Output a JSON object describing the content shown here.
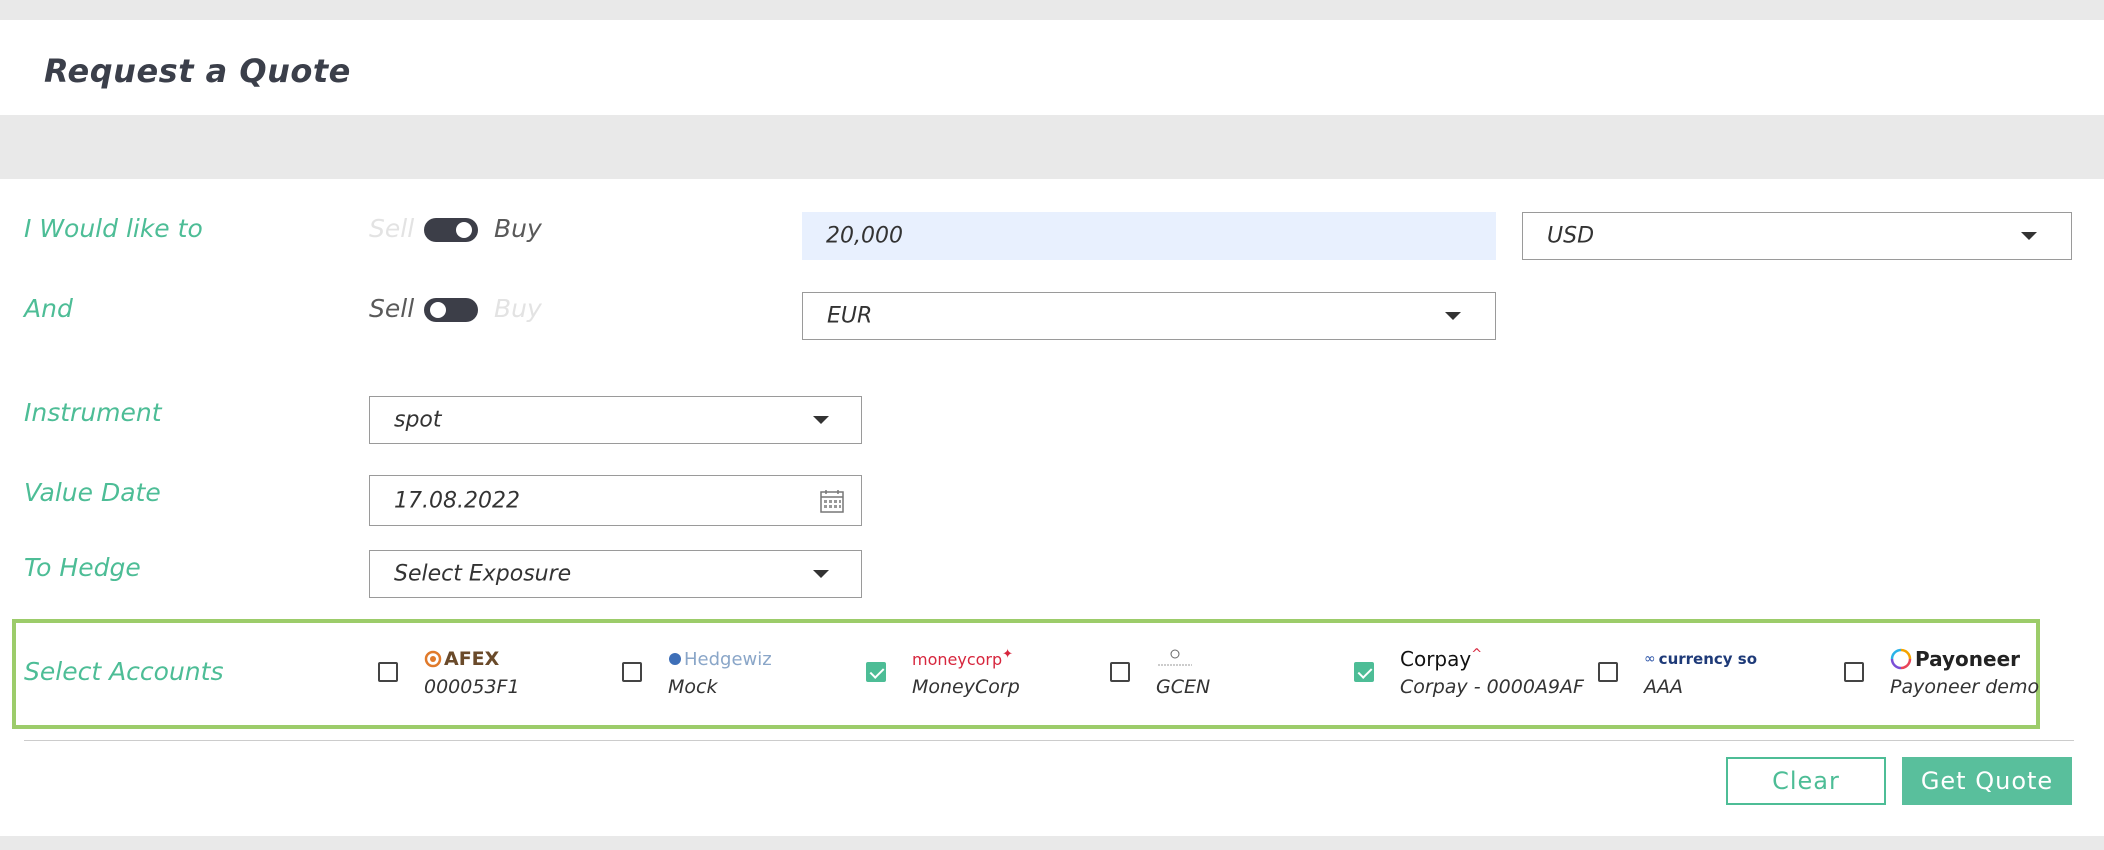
{
  "title": "Request a Quote",
  "row1": {
    "label": "I Would like to",
    "sell": "Sell",
    "buy": "Buy",
    "selected": "Buy",
    "amount": "20,000",
    "currency": "USD"
  },
  "row2": {
    "label": "And",
    "sell": "Sell",
    "buy": "Buy",
    "selected": "Sell",
    "currency": "EUR"
  },
  "instrument": {
    "label": "Instrument",
    "value": "spot"
  },
  "value_date": {
    "label": "Value Date",
    "value": "17.08.2022"
  },
  "to_hedge": {
    "label": "To Hedge",
    "value": "Select Exposure"
  },
  "accounts": {
    "label": "Select Accounts",
    "items": [
      {
        "logo": "AFEX",
        "name": "000053F1",
        "checked": false
      },
      {
        "logo": "Hedgewiz",
        "name": "Mock",
        "checked": false
      },
      {
        "logo": "moneycorp",
        "name": "MoneyCorp",
        "checked": true
      },
      {
        "logo": "GCEN",
        "name": "GCEN",
        "checked": false
      },
      {
        "logo": "Corpay",
        "name": "Corpay - 0000A9AF",
        "checked": true
      },
      {
        "logo": "currency so",
        "name": "AAA",
        "checked": false
      },
      {
        "logo": "Payoneer",
        "name": "Payoneer demo",
        "checked": false
      }
    ]
  },
  "buttons": {
    "clear": "Clear",
    "get_quote": "Get Quote"
  },
  "colors": {
    "accent": "#4dbd96",
    "highlight_border": "#9ccc6a",
    "toggle": "#3c3e48"
  }
}
